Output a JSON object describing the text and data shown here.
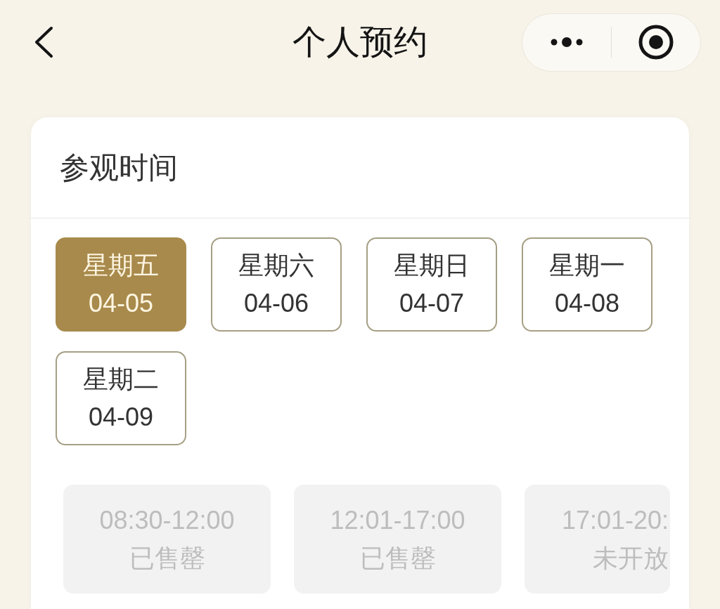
{
  "header": {
    "title": "个人预约"
  },
  "visit_time": {
    "title": "参观时间",
    "dates": [
      {
        "weekday": "星期五",
        "date": "04-05",
        "selected": true
      },
      {
        "weekday": "星期六",
        "date": "04-06",
        "selected": false
      },
      {
        "weekday": "星期日",
        "date": "04-07",
        "selected": false
      },
      {
        "weekday": "星期一",
        "date": "04-08",
        "selected": false
      },
      {
        "weekday": "星期二",
        "date": "04-09",
        "selected": false
      }
    ],
    "slots": [
      {
        "time": "08:30-12:00",
        "status": "已售罄",
        "disabled": true
      },
      {
        "time": "12:01-17:00",
        "status": "已售罄",
        "disabled": true
      },
      {
        "time": "17:01-20:",
        "status": "未开放",
        "disabled": true
      }
    ]
  }
}
